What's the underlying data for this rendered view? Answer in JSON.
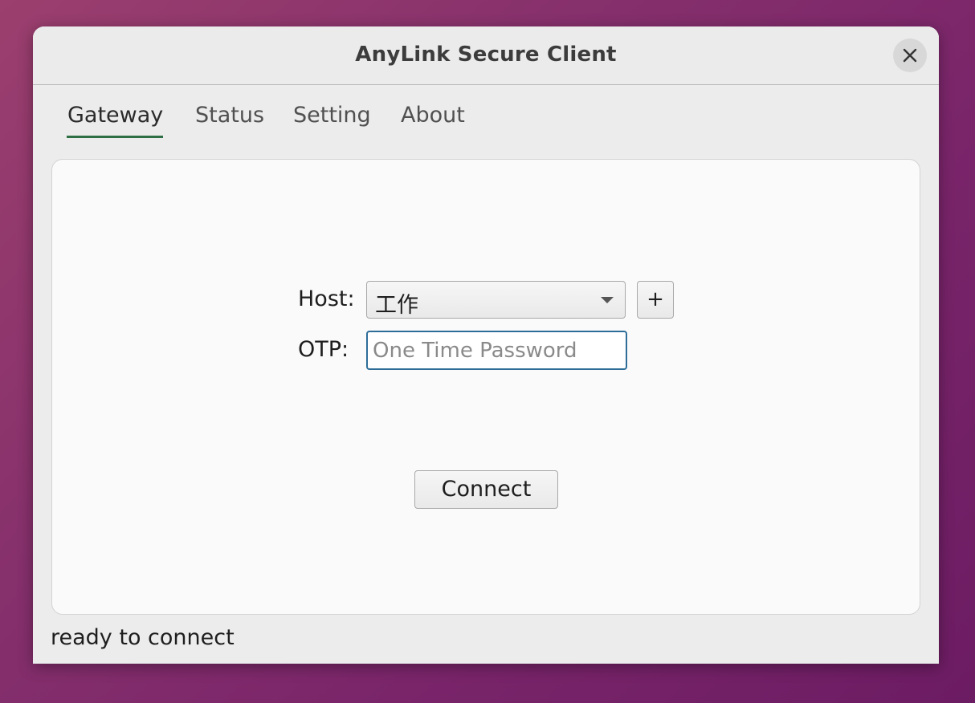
{
  "window": {
    "title": "AnyLink Secure Client"
  },
  "tabs": [
    {
      "label": "Gateway",
      "active": true
    },
    {
      "label": "Status",
      "active": false
    },
    {
      "label": "Setting",
      "active": false
    },
    {
      "label": "About",
      "active": false
    }
  ],
  "gateway": {
    "host_label": "Host:",
    "host_selected": "工作",
    "add_host_label": "+",
    "otp_label": "OTP:",
    "otp_value": "",
    "otp_placeholder": "One Time Password",
    "connect_label": "Connect"
  },
  "statusbar": {
    "text": "ready to connect"
  },
  "icons": {
    "close": "close-icon",
    "dropdown": "chevron-down-icon"
  },
  "colors": {
    "active_tab_underline": "#2e6f45",
    "focus_border": "#2d6d98"
  }
}
